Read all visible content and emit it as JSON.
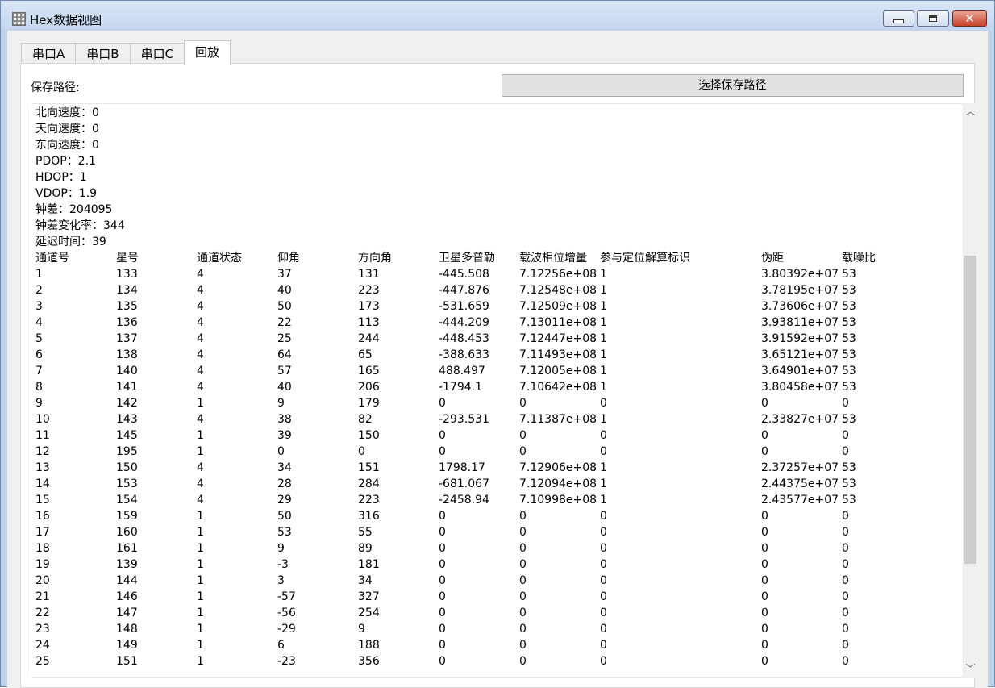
{
  "window": {
    "title": "Hex数据视图",
    "icons": {
      "app": "table-grid-icon",
      "minimize": "minimize-icon",
      "maximize": "maximize-icon",
      "close": "close-icon"
    },
    "colors": {
      "titlebar": "#c3d5ee",
      "close_button": "#c9432c"
    }
  },
  "tabs": [
    {
      "label": "串口A",
      "active": false
    },
    {
      "label": "串口B",
      "active": false
    },
    {
      "label": "串口C",
      "active": false
    },
    {
      "label": "回放",
      "active": true
    }
  ],
  "save": {
    "path_label": "保存路径:",
    "button_label": "选择保存路径"
  },
  "info_lines": [
    "北向速度：0",
    "天向速度：0",
    "东向速度：0",
    "PDOP：2.1",
    "HDOP：1",
    "VDOP：1.9",
    "钟差：204095",
    "钟差变化率：344",
    "延迟时间：39"
  ],
  "table": {
    "headers": [
      "通道号",
      "星号",
      "通道状态",
      "仰角",
      "方向角",
      "卫星多普勒",
      "载波相位增量",
      "参与定位解算标识",
      "伪距",
      "载噪比"
    ],
    "rows": [
      [
        "1",
        "133",
        "4",
        "37",
        "131",
        "-445.508",
        "7.12256e+08",
        "1",
        "3.80392e+07",
        "53"
      ],
      [
        "2",
        "134",
        "4",
        "40",
        "223",
        "-447.876",
        "7.12548e+08",
        "1",
        "3.78195e+07",
        "53"
      ],
      [
        "3",
        "135",
        "4",
        "50",
        "173",
        "-531.659",
        "7.12509e+08",
        "1",
        "3.73606e+07",
        "53"
      ],
      [
        "4",
        "136",
        "4",
        "22",
        "113",
        "-444.209",
        "7.13011e+08",
        "1",
        "3.93811e+07",
        "53"
      ],
      [
        "5",
        "137",
        "4",
        "25",
        "244",
        "-448.453",
        "7.12447e+08",
        "1",
        "3.91592e+07",
        "53"
      ],
      [
        "6",
        "138",
        "4",
        "64",
        "65",
        "-388.633",
        "7.11493e+08",
        "1",
        "3.65121e+07",
        "53"
      ],
      [
        "7",
        "140",
        "4",
        "57",
        "165",
        "488.497",
        "7.12005e+08",
        "1",
        "3.64901e+07",
        "53"
      ],
      [
        "8",
        "141",
        "4",
        "40",
        "206",
        "-1794.1",
        "7.10642e+08",
        "1",
        "3.80458e+07",
        "53"
      ],
      [
        "9",
        "142",
        "1",
        "9",
        "179",
        "0",
        "0",
        "0",
        "0",
        "0"
      ],
      [
        "10",
        "143",
        "4",
        "38",
        "82",
        "-293.531",
        "7.11387e+08",
        "1",
        "2.33827e+07",
        "53"
      ],
      [
        "11",
        "145",
        "1",
        "39",
        "150",
        "0",
        "0",
        "0",
        "0",
        "0"
      ],
      [
        "12",
        "195",
        "1",
        "0",
        "0",
        "0",
        "0",
        "0",
        "0",
        "0"
      ],
      [
        "13",
        "150",
        "4",
        "34",
        "151",
        "1798.17",
        "7.12906e+08",
        "1",
        "2.37257e+07",
        "53"
      ],
      [
        "14",
        "153",
        "4",
        "28",
        "284",
        "-681.067",
        "7.12094e+08",
        "1",
        "2.44375e+07",
        "53"
      ],
      [
        "15",
        "154",
        "4",
        "29",
        "223",
        "-2458.94",
        "7.10998e+08",
        "1",
        "2.43577e+07",
        "53"
      ],
      [
        "16",
        "159",
        "1",
        "50",
        "316",
        "0",
        "0",
        "0",
        "0",
        "0"
      ],
      [
        "17",
        "160",
        "1",
        "53",
        "55",
        "0",
        "0",
        "0",
        "0",
        "0"
      ],
      [
        "18",
        "161",
        "1",
        "9",
        "89",
        "0",
        "0",
        "0",
        "0",
        "0"
      ],
      [
        "19",
        "139",
        "1",
        "-3",
        "181",
        "0",
        "0",
        "0",
        "0",
        "0"
      ],
      [
        "20",
        "144",
        "1",
        "3",
        "34",
        "0",
        "0",
        "0",
        "0",
        "0"
      ],
      [
        "21",
        "146",
        "1",
        "-57",
        "327",
        "0",
        "0",
        "0",
        "0",
        "0"
      ],
      [
        "22",
        "147",
        "1",
        "-56",
        "254",
        "0",
        "0",
        "0",
        "0",
        "0"
      ],
      [
        "23",
        "148",
        "1",
        "-29",
        "9",
        "0",
        "0",
        "0",
        "0",
        "0"
      ],
      [
        "24",
        "149",
        "1",
        "6",
        "188",
        "0",
        "0",
        "0",
        "0",
        "0"
      ],
      [
        "25",
        "151",
        "1",
        "-23",
        "356",
        "0",
        "0",
        "0",
        "0",
        "0"
      ]
    ]
  },
  "scrollbar": {
    "up_icon": "chevron-up-icon",
    "down_icon": "chevron-down-icon"
  }
}
